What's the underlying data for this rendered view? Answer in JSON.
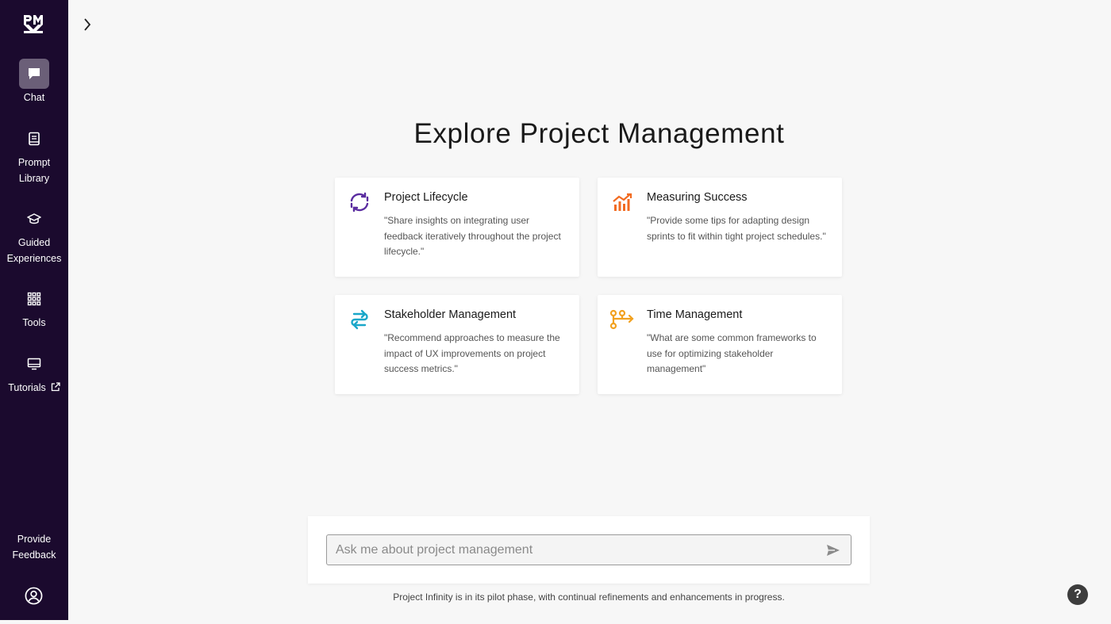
{
  "sidebar": {
    "logo_text": "PMI",
    "items": [
      {
        "label": "Chat",
        "icon": "chat-icon",
        "active": true
      },
      {
        "label": "Prompt Library",
        "icon": "book-icon"
      },
      {
        "label": "Guided Experiences",
        "icon": "graduation-cap-icon"
      },
      {
        "label": "Tools",
        "icon": "grid-icon"
      },
      {
        "label": "Tutorials",
        "icon": "monitor-icon"
      }
    ],
    "feedback_label": "Provide Feedback"
  },
  "main": {
    "title": "Explore Project Management",
    "cards": [
      {
        "title": "Project Lifecycle",
        "text": "\"Share insights on integrating user feedback iteratively throughout the project lifecycle.\"",
        "icon": "cycle-arrows-icon",
        "color": "#5a2ca0"
      },
      {
        "title": "Measuring Success",
        "text": "\"Provide some tips for adapting design sprints to fit within tight project schedules.\"",
        "icon": "bar-chart-icon",
        "color": "#f26b21"
      },
      {
        "title": "Stakeholder Management",
        "text": "\"Recommend approaches to measure the impact of UX improvements on project success metrics.\"",
        "icon": "exchange-arrows-icon",
        "color": "#1aa7c9"
      },
      {
        "title": "Time Management",
        "text": "\"What are some common frameworks to use for optimizing stakeholder management\"",
        "icon": "workflow-icon",
        "color": "#f2a11f"
      }
    ],
    "input_placeholder": "Ask me about project management",
    "footnote": "Project Infinity is in its pilot phase, with continual refinements and enhancements in progress.",
    "help_label": "?"
  },
  "colors": {
    "sidebar_bg": "#1b0a2e",
    "active_bg": "#6b5f78",
    "page_bg": "#f7f7f7"
  }
}
